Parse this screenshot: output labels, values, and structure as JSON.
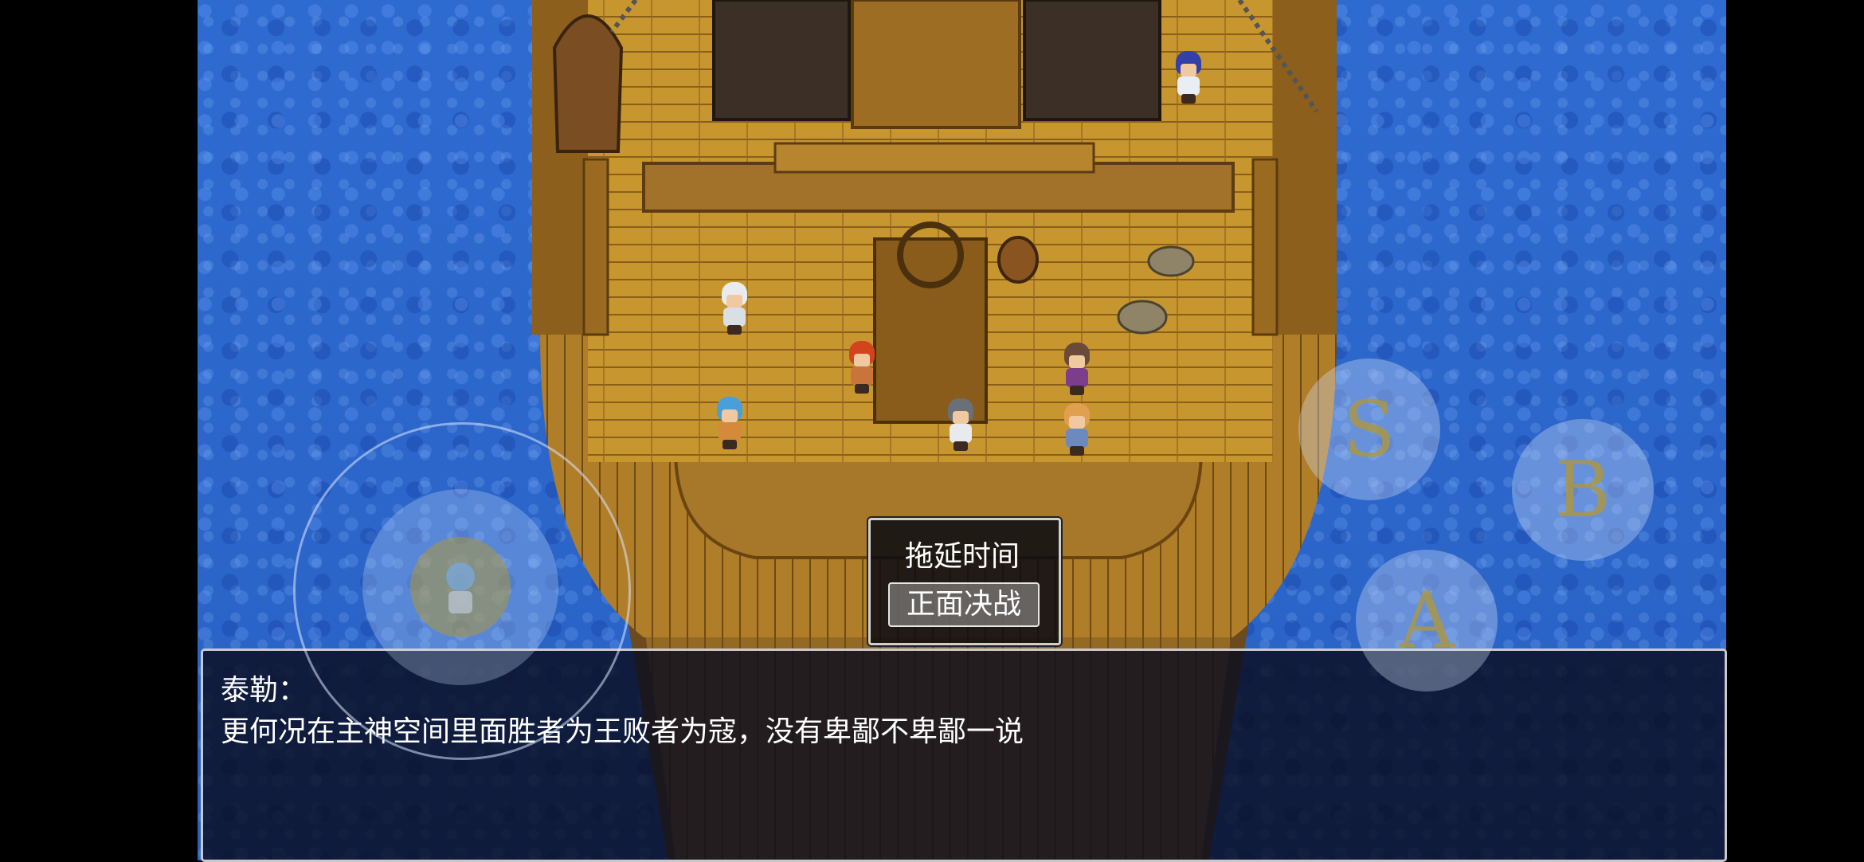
{
  "choices": [
    {
      "label": "拖延时间",
      "selected": false
    },
    {
      "label": "正面决战",
      "selected": true
    }
  ],
  "dialog": {
    "speaker": "泰勒：",
    "message": "更何况在主神空间里面胜者为王败者为寇，没有卑鄙不卑鄙一说"
  },
  "controls": {
    "s_label": "S",
    "b_label": "B",
    "a_label": "A"
  },
  "colors": {
    "ocean": "#2a62c4",
    "deck": "#c8962f",
    "dialog_bg": "#0a0c1e"
  }
}
